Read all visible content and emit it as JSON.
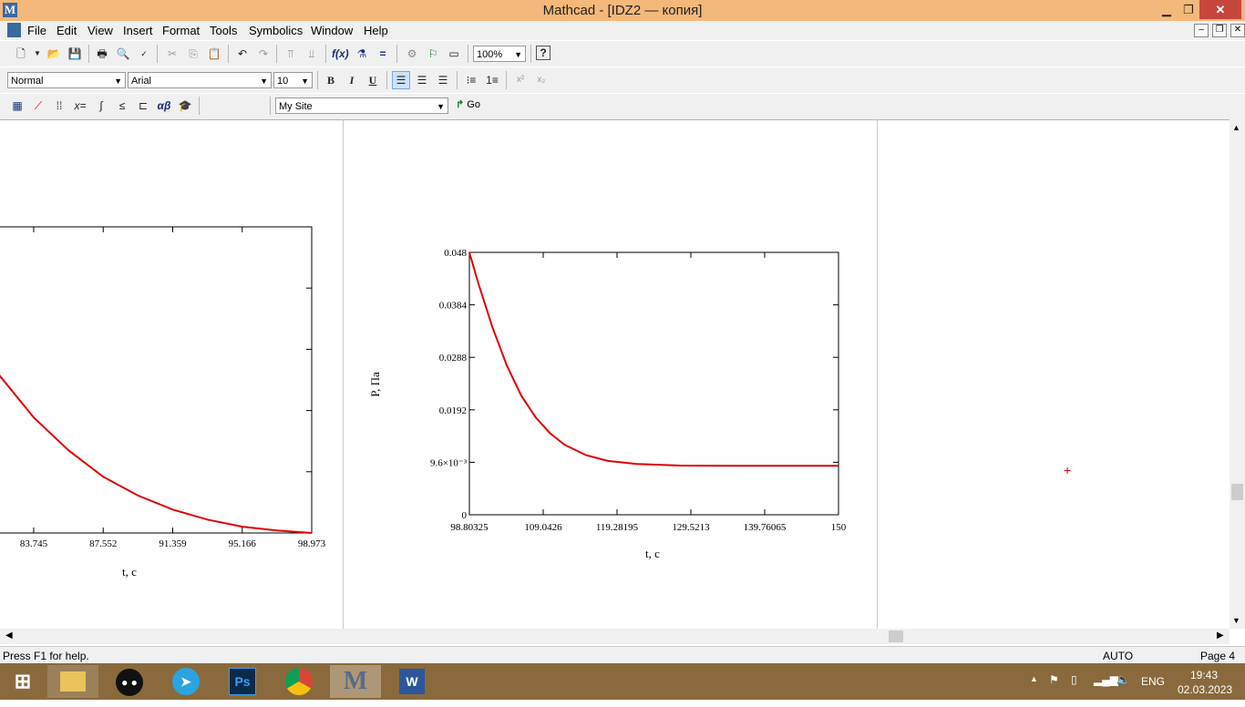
{
  "window": {
    "title": "Mathcad - [IDZ2 — копия]",
    "logo": "M",
    "minimize": "▁",
    "restore": "❐",
    "close": "✕"
  },
  "menu": [
    "File",
    "Edit",
    "View",
    "Insert",
    "Format",
    "Tools",
    "Symbolics",
    "Window",
    "Help"
  ],
  "mdi_controls": [
    "–",
    "❐",
    "✕"
  ],
  "toolbar_standard": {
    "zoom": "100%"
  },
  "toolbar_formatting": {
    "style": "Normal",
    "font": "Arial",
    "size": "10",
    "bold": "B",
    "italic": "I",
    "underline": "U"
  },
  "toolbar_math": {
    "site": "My Site",
    "go": "Go"
  },
  "chart_data": [
    {
      "type": "line",
      "xlabel": "t, c",
      "ylabel": "",
      "x_ticks": [
        "83.745",
        "87.552",
        "91.359",
        "95.166",
        "98.973"
      ],
      "xlim": [
        81.8,
        98.973
      ],
      "series": [
        {
          "x": [
            81.8,
            83.745,
            85.65,
            87.552,
            89.46,
            91.359,
            93.26,
            95.166,
            97.07,
            98.973
          ],
          "y": [
            0.51,
            0.37,
            0.265,
            0.18,
            0.12,
            0.075,
            0.043,
            0.02,
            0.008,
            0.0
          ],
          "color": "#e00000"
        }
      ]
    },
    {
      "type": "line",
      "xlabel": "t, c",
      "ylabel": "P, Па",
      "x_ticks": [
        "98.80325",
        "109.0426",
        "119.28195",
        "129.5213",
        "139.76065",
        "150"
      ],
      "y_ticks": [
        "0",
        "9.6×10⁻³",
        "0.0192",
        "0.0288",
        "0.0384",
        "0.048"
      ],
      "xlim": [
        98.80325,
        150
      ],
      "ylim": [
        0,
        0.048
      ],
      "series": [
        {
          "x": [
            98.80325,
            100,
            102,
            104,
            106,
            108,
            110,
            112,
            115,
            118,
            122,
            128,
            135,
            142,
            150
          ],
          "y": [
            0.048,
            0.0425,
            0.0343,
            0.0273,
            0.0218,
            0.0178,
            0.0149,
            0.0128,
            0.0109,
            0.00985,
            0.0093,
            0.009,
            0.00895,
            0.00895,
            0.00895
          ],
          "color": "#e00000"
        }
      ]
    }
  ],
  "status": {
    "help": "Press F1 for help.",
    "mode": "AUTO",
    "page": "Page 4"
  },
  "taskbar": {
    "lang": "ENG",
    "time": "19:43",
    "date": "02.03.2023",
    "apps": [
      "Windows Explorer",
      "Panda",
      "Telegram",
      "Photoshop",
      "Chrome",
      "Mathcad",
      "Word"
    ],
    "ps_label": "Ps",
    "word_label": "W",
    "mathcad_label": "M"
  },
  "colors": {
    "titlebar": "#f4b87a",
    "curve": "#e00000",
    "taskbar": "#8a6a3c"
  }
}
